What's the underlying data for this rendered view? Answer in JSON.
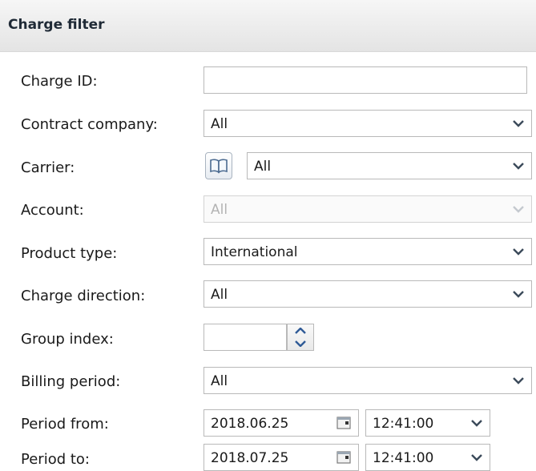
{
  "header": {
    "title": "Charge filter"
  },
  "labels": {
    "charge_id": "Charge ID:",
    "contract_company": "Contract company:",
    "carrier": "Carrier:",
    "account": "Account:",
    "product_type": "Product type:",
    "charge_direction": "Charge direction:",
    "group_index": "Group index:",
    "billing_period": "Billing period:",
    "period_from": "Period from:",
    "period_to": "Period to:"
  },
  "values": {
    "charge_id": "",
    "contract_company": "All",
    "carrier": "All",
    "account": "All",
    "product_type": "International",
    "charge_direction": "All",
    "group_index": "",
    "billing_period": "All",
    "period_from_date": "2018.06.25",
    "period_from_time": "12:41:00",
    "period_to_date": "2018.07.25",
    "period_to_time": "12:41:00"
  },
  "icons": {
    "dropdown": "chevron-down-icon",
    "carrier_lookup": "book-icon",
    "calendar": "calendar-icon",
    "spinner": "spinner-arrows-icon"
  },
  "colors": {
    "border": "#b9b9b9",
    "disabled_text": "#b3b3b3",
    "arrow": "#3b4a5a"
  }
}
